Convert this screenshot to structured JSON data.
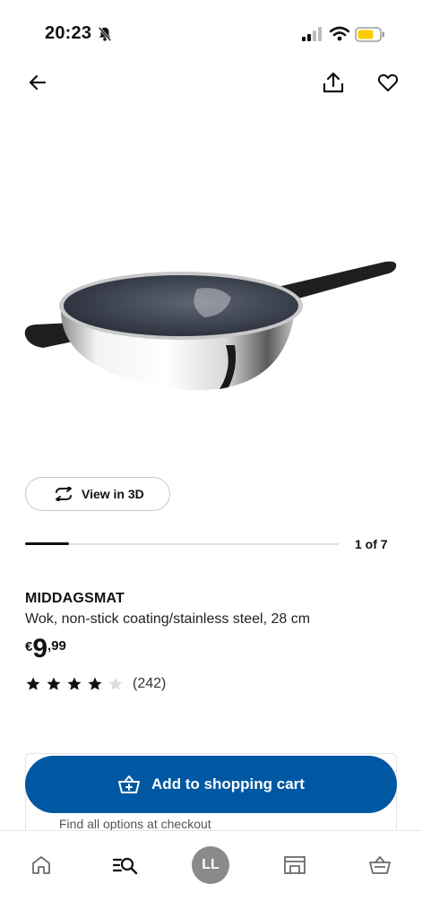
{
  "status_bar": {
    "time": "20:23"
  },
  "top_bar": {
    "back_icon": "arrow-left-icon",
    "share_icon": "share-icon",
    "favourite_icon": "heart-icon"
  },
  "product": {
    "view_3d_label": "View in 3D",
    "image_count": "1 of 7",
    "image_progress": 0.14,
    "name": "MIDDAGSMAT",
    "description": "Wok, non-stick coating/stainless steel, 28 cm",
    "price": {
      "currency": "€",
      "integer": "9",
      "decimal": ",99"
    },
    "rating": {
      "stars": 4,
      "max": 5,
      "count": "(242)"
    }
  },
  "cart": {
    "button_label": "Add to shopping cart",
    "note": "Find all options at checkout"
  },
  "bottom_nav": {
    "items": [
      {
        "name": "home",
        "icon": "home-icon"
      },
      {
        "name": "search",
        "icon": "search-icon"
      },
      {
        "name": "profile",
        "avatar_text": "LL"
      },
      {
        "name": "stores",
        "icon": "store-icon"
      },
      {
        "name": "cart",
        "icon": "basket-icon"
      }
    ]
  },
  "colors": {
    "brand_blue": "#0058a3",
    "battery_yellow": "#ffcc00"
  }
}
